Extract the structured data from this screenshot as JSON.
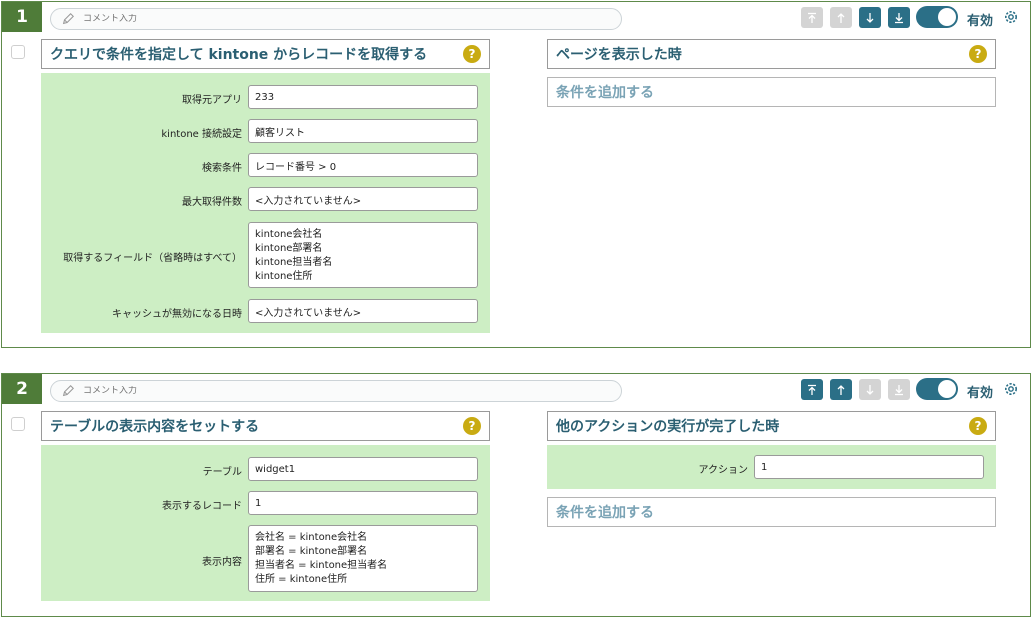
{
  "comment_placeholder": "コメント入力",
  "enabled_label": "有効",
  "help_mark": "?",
  "add_condition_label": "条件を追加する",
  "cards": [
    {
      "number": "1",
      "action_title": "クエリで条件を指定して kintone からレコードを取得する",
      "condition_title": "ページを表示した時",
      "fields": [
        {
          "label": "取得元アプリ",
          "value": "233"
        },
        {
          "label": "kintone 接続設定",
          "value": "顧客リスト"
        },
        {
          "label": "検索条件",
          "value": "レコード番号 > 0"
        },
        {
          "label": "最大取得件数",
          "value": "<入力されていません>"
        },
        {
          "label": "取得するフィールド（省略時はすべて）",
          "lines": [
            "kintone会社名",
            "kintone部署名",
            "kintone担当者名",
            "kintone住所"
          ]
        },
        {
          "label": "キャッシュが無効になる日時",
          "value": "<入力されていません>"
        }
      ]
    },
    {
      "number": "2",
      "action_title": "テーブルの表示内容をセットする",
      "condition_title": "他のアクションの実行が完了した時",
      "fields": [
        {
          "label": "テーブル",
          "value": "widget1"
        },
        {
          "label": "表示するレコード",
          "value": "1"
        },
        {
          "label": "表示内容",
          "lines": [
            "会社名 = kintone会社名",
            "部署名 = kintone部署名",
            "担当者名 = kintone担当者名",
            "住所 = kintone住所"
          ]
        }
      ],
      "condition_fields": [
        {
          "label": "アクション",
          "value": "1"
        }
      ]
    }
  ],
  "icons": {
    "comment": "pencil-icon",
    "move_top": "move-to-top-icon",
    "move_up": "arrow-up-icon",
    "move_down": "arrow-down-icon",
    "move_bottom": "move-to-bottom-icon",
    "settings": "gear-icon",
    "help": "question-icon"
  },
  "colors": {
    "card_border": "#5e8a4a",
    "badge_bg": "#4f7c39",
    "accent": "#2b6f87",
    "title_text": "#2b5f72",
    "field_panel_bg": "#cdeec4",
    "help_bg": "#c9ab12",
    "disabled_button": "#d4d4d4",
    "add_condition_text": "#7aa3b5"
  }
}
